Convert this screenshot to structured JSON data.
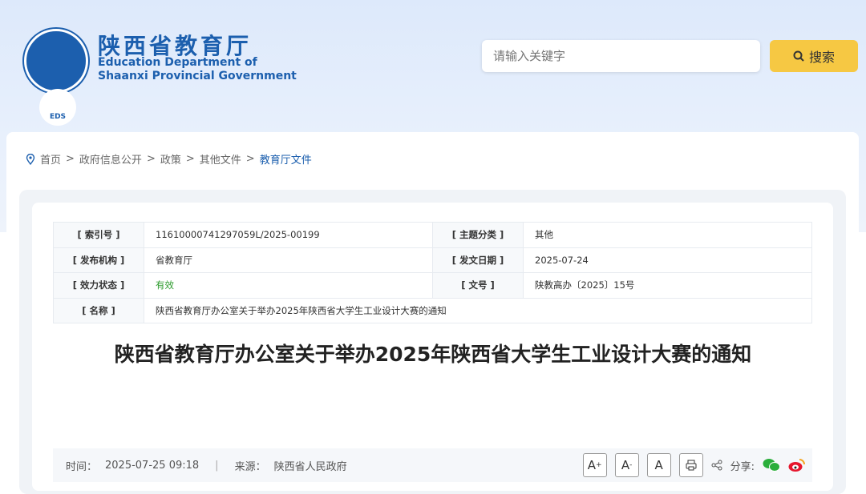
{
  "header": {
    "logo_text": "EDS",
    "title_cn": "陕西省教育厅",
    "title_en_1": "Education Department of",
    "title_en_2": "Shaanxi Provincial Government",
    "search_placeholder": "请输入关键字",
    "search_button": "搜索"
  },
  "breadcrumb": [
    "首页",
    "政府信息公开",
    "政策",
    "其他文件",
    "教育厅文件"
  ],
  "info": {
    "index_label": "[ 索引号 ]",
    "index": "11610000741297059L/2025-00199",
    "topic_label": "[ 主题分类 ]",
    "topic": "其他",
    "org_label": "[ 发布机构 ]",
    "org": "省教育厅",
    "date_label": "[ 发文日期 ]",
    "date": "2025-07-24",
    "status_label": "[ 效力状态 ]",
    "status": "有效",
    "docno_label": "[ 文号 ]",
    "docno": "陕教高办〔2025〕15号",
    "name_label": "[ 名称 ]",
    "name": "陕西省教育厅办公室关于举办2025年陕西省大学生工业设计大赛的通知"
  },
  "article": {
    "title": "陕西省教育厅办公室关于举办2025年陕西省大学生工业设计大赛的通知",
    "time_label": "时间：",
    "time": "2025-07-25 09:18",
    "sep": "|",
    "source_label": "来源：",
    "source": "陕西省人民政府",
    "font_up": "A",
    "font_down": "A",
    "font_reset": "A",
    "share_label": "分享:"
  },
  "colors": {
    "brand": "#1c5fae",
    "accent": "#f6c843",
    "valid": "#2a9a2a"
  }
}
